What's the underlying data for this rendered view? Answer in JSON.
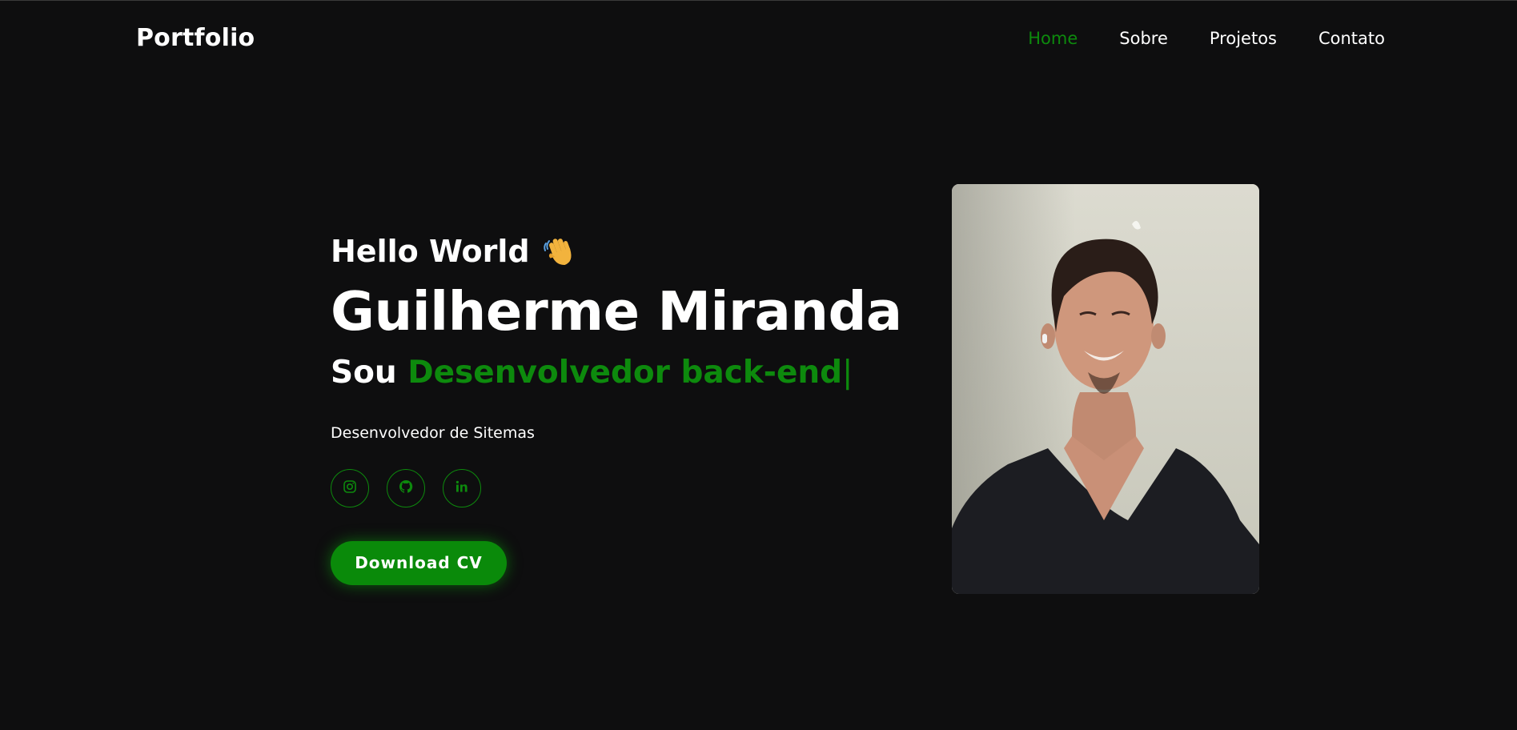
{
  "header": {
    "logo": "Portfolio",
    "nav": [
      {
        "label": "Home",
        "active": true
      },
      {
        "label": "Sobre",
        "active": false
      },
      {
        "label": "Projetos",
        "active": false
      },
      {
        "label": "Contato",
        "active": false
      }
    ]
  },
  "hero": {
    "greeting": "Hello World",
    "greeting_icon": "waving-hand-icon",
    "name": "Guilherme Miranda",
    "role_prefix": "Sou",
    "role_highlight": "Desenvolvedor back-end",
    "cursor": "|",
    "subtitle": "Desenvolvedor de Sitemas",
    "socials": [
      {
        "icon": "instagram-icon"
      },
      {
        "icon": "github-icon"
      },
      {
        "icon": "linkedin-icon"
      }
    ],
    "download_label": "Download CV",
    "photo_icon": "profile-photo"
  },
  "colors": {
    "background": "#0e0e0f",
    "accent": "#0d8a0d",
    "text": "#ffffff"
  }
}
